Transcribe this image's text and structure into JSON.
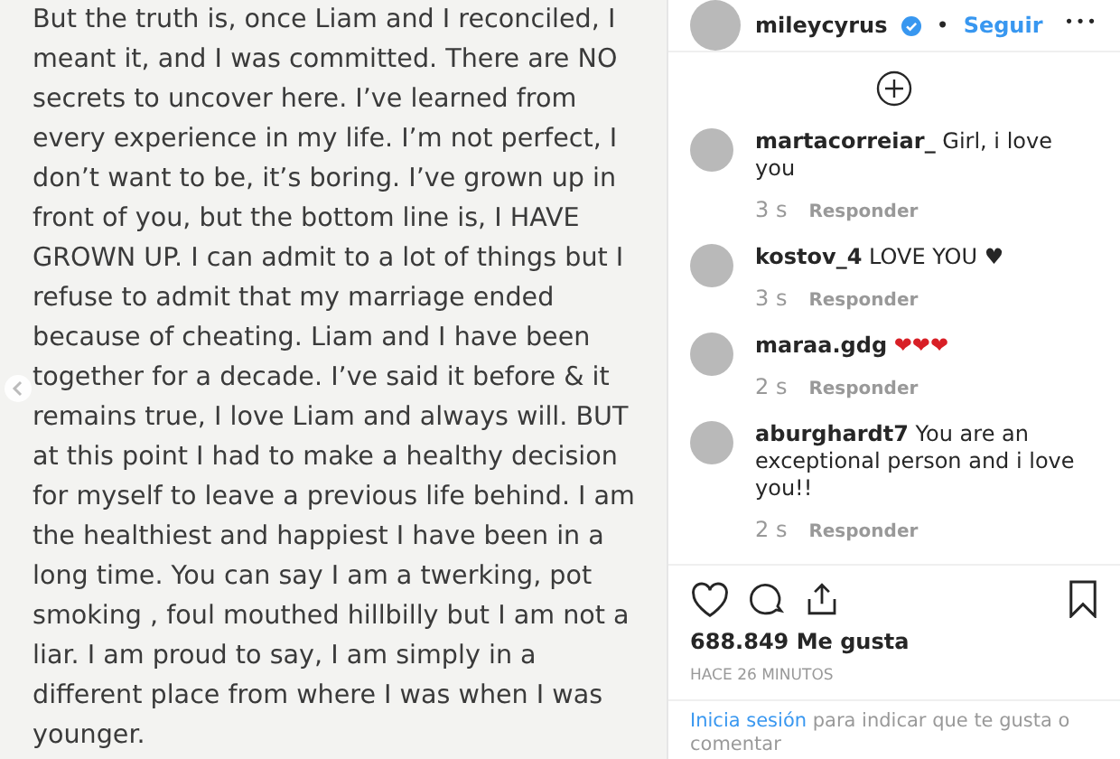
{
  "post": {
    "lines": [
      "But the truth is, once Liam and I reconciled, I",
      "meant it, and I was committed. There are NO",
      "secrets to uncover here. I’ve learned from",
      "every experience in my life. I’m not perfect, I",
      "don’t want to be, it’s boring. I’ve grown up in",
      "front of you, but the bottom line is, I HAVE",
      "GROWN UP. I can admit to a lot of things but I",
      "refuse to admit that my marriage ended",
      "because of cheating. Liam and I have been",
      "together for a decade. I’ve said it before & it",
      "remains true, I love Liam and always will. BUT",
      "at this point I had to make a healthy decision",
      "for myself to leave a previous life behind. I am",
      "the healthiest and happiest I have been in a",
      "long time.  You can say I am a twerking, pot",
      "smoking , foul mouthed hillbilly but I am not a",
      "liar. I am proud to say, I am simply in a",
      "different place from where I was when I was",
      "younger."
    ]
  },
  "header": {
    "username": "mileycyrus",
    "verified": true,
    "separator": "•",
    "follow": "Seguir",
    "more": "•••"
  },
  "comments": [
    {
      "user": "martacorreiar_",
      "text": "Girl, i love you",
      "color": "#262626",
      "time": "3 s",
      "reply": "Responder"
    },
    {
      "user": "kostov_4",
      "text": "LOVE YOU ♥",
      "color": "#262626",
      "time": "3 s",
      "reply": "Responder"
    },
    {
      "user": "maraa.gdg",
      "text": "❤❤❤",
      "color": "#d81f26",
      "time": "2 s",
      "reply": "Responder"
    },
    {
      "user": "aburghardt7",
      "text": "You are an exceptional person and i love you!!",
      "color": "#262626",
      "time": "2 s",
      "reply": "Responder"
    }
  ],
  "likes": "688.849 Me gusta",
  "posted": "HACE 26 MINUTOS",
  "login": {
    "link": "Inicia sesión",
    "rest": "para indicar que te gusta o comentar"
  }
}
